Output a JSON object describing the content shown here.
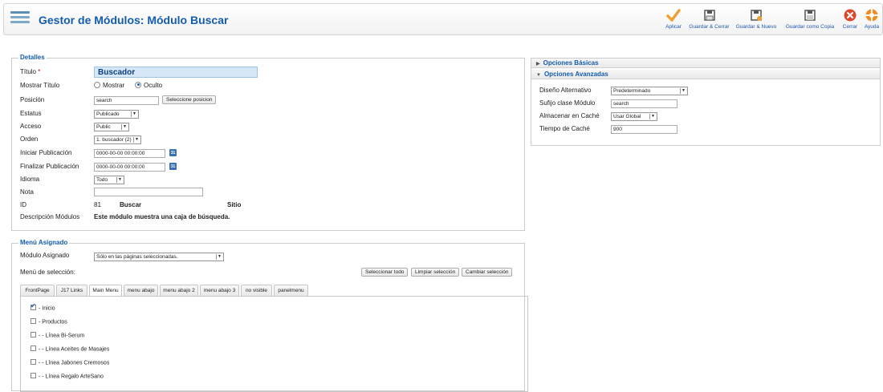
{
  "header": {
    "title": "Gestor de Módulos: Módulo Buscar",
    "toolbar": [
      {
        "key": "apply",
        "label": "Aplicar",
        "icon": "check-icon"
      },
      {
        "key": "save_close",
        "label": "Guardar & Cerrar",
        "icon": "save-icon"
      },
      {
        "key": "save_new",
        "label": "Guardar & Nuevo",
        "icon": "save-new-icon"
      },
      {
        "key": "save_copy",
        "label": "Guardar como Copia",
        "icon": "save-copy-icon"
      },
      {
        "key": "close",
        "label": "Cerrar",
        "icon": "close-icon"
      },
      {
        "key": "help",
        "label": "Ayuda",
        "icon": "help-icon"
      }
    ]
  },
  "details": {
    "legend": "Detalles",
    "title_label": "Título",
    "title_required": "*",
    "title_value": "Buscador",
    "show_title_label": "Mostrar Título",
    "show_title_options": [
      "Mostrar",
      "Oculto"
    ],
    "show_title_selected": "Oculto",
    "position_label": "Posición",
    "position_value": "search",
    "position_button": "Seleccione posicion",
    "status_label": "Estatus",
    "status_value": "Publicado",
    "access_label": "Acceso",
    "access_value": "Public",
    "order_label": "Orden",
    "order_value": "1. buscador (2)",
    "publish_up_label": "Iniciar Publicación",
    "publish_up_value": "0000-00-00 00:00:00",
    "publish_down_label": "Finalizar Publicación",
    "publish_down_value": "0000-00-00 00:00:00",
    "calendar_text": "31",
    "language_label": "Idioma",
    "language_value": "Todo",
    "note_label": "Nota",
    "note_value": "",
    "id_label": "ID",
    "id_value": "81",
    "id_type": "Buscar",
    "id_site": "Sitio",
    "desc_label": "Descripción Módulos",
    "desc_value": "Este módulo muestra una caja de búsqueda."
  },
  "options": {
    "basic_label": "Opciones Básicas",
    "advanced_label": "Opciones Avanzadas",
    "layout_label": "Diseño Alternativo",
    "layout_value": "Predeterminado",
    "suffix_label": "Sufijo clase Módulo",
    "suffix_value": "search",
    "cache_label": "Almacenar en Caché",
    "cache_value": "Usar Global",
    "cache_time_label": "Tiempo de Caché",
    "cache_time_value": "900"
  },
  "menu_assignment": {
    "legend": "Menú Asignado",
    "module_assigned_label": "Módulo Asignado",
    "module_assigned_value": "Sólo en las páginas seleccionadas.",
    "selection_label": "Menú de selección:",
    "btn_select_all": "Seleccionar todo",
    "btn_clear": "Limpiar selección",
    "btn_toggle": "Cambiar selección",
    "tabs": [
      "FrontPage",
      "J17 Links",
      "Main Menu",
      "menu abajo",
      "menu abajo 2",
      "menu abajo 3",
      "no visible",
      "panelmenu"
    ],
    "active_tab": "Main Menu",
    "items": [
      {
        "label": "- Inicio",
        "checked": true
      },
      {
        "label": "- Productos",
        "checked": false
      },
      {
        "label": "- - Línea Bi-Serum",
        "checked": false
      },
      {
        "label": "- - Línea Aceites de Masajes",
        "checked": false
      },
      {
        "label": "- - Línea Jabones Cremosos",
        "checked": false
      },
      {
        "label": "- - Línea Regalo ArteSano",
        "checked": false
      }
    ]
  },
  "colors": {
    "accent": "#135cae",
    "apply": "#f0a030",
    "close": "#e0452a",
    "help": "#f28c1e"
  }
}
